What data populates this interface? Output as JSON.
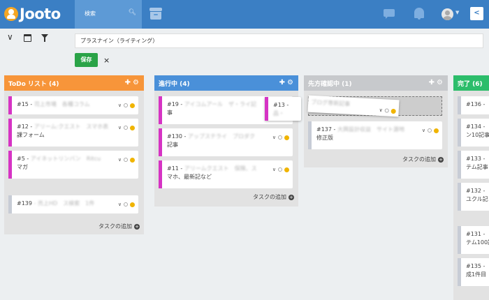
{
  "header": {
    "logo_text": "Jooto",
    "search_label": "検索"
  },
  "toolbar": {
    "project_title": "プラスナイン（ライティング）",
    "save_label": "保存",
    "cancel_label": "×"
  },
  "columns": [
    {
      "title": "ToDo リスト (4)",
      "color": "#f7953a",
      "cards": [
        {
          "id": "#15 -",
          "text": "司上市場　各種コラム",
          "text2": "",
          "bar": "#d633c4"
        },
        {
          "id": "#12 -",
          "text": "アリーム:クエスト　スマホ表",
          "text2": "課フォーム",
          "bar": "#d633c4"
        },
        {
          "id": "#5 -",
          "text": "アイネットリンバン　Ritcu",
          "text2": "マガ",
          "bar": "#d633c4"
        },
        {
          "id": "#139",
          "text": "- 売上HD　ス検索　1件",
          "text2": "",
          "bar": "#c7ccd6"
        }
      ],
      "add_label": "タスクの追加"
    },
    {
      "title": "進行中 (4)",
      "color": "#4a90d9",
      "cards": [
        {
          "id": "#19 -",
          "text": "アイコムアール　ザ・ライ記",
          "text2": "事",
          "bar": "#d633c4"
        },
        {
          "id": "#130 -",
          "text": "アップステライ　プロダク",
          "text2": "記事",
          "bar": "#d633c4"
        },
        {
          "id": "#11 -",
          "text": "アリームクエスト　保険、ス",
          "text2": "マホ、最新記など",
          "bar": "#d633c4"
        }
      ],
      "dragging": {
        "id": "#13 -",
        "text": "品・",
        "bar": "#d633c4"
      },
      "add_label": "タスクの追加"
    },
    {
      "title": "先方確認中 (1)",
      "color": "#c7c9cc",
      "floating_text": "ブログ専新記事",
      "cards": [
        {
          "id": "#137 -",
          "text": "大興設計収益　サイト源地",
          "text2": "修正版",
          "bar": "#c7ccd6"
        }
      ],
      "add_label": "タスクの追加"
    },
    {
      "title": "完了 (6)",
      "color": "#2cbd6b",
      "cards": [
        {
          "id": "#136 -",
          "text": "",
          "text2": ""
        },
        {
          "id": "#134 -",
          "text": "",
          "text2": "ン10記事"
        },
        {
          "id": "#133 -",
          "text": "",
          "text2": "テム記事"
        },
        {
          "id": "#132 -",
          "text": "",
          "text2": "ユクル記"
        },
        {
          "id": "#131 -",
          "text": "",
          "text2": "テム100記"
        },
        {
          "id": "#135 -",
          "text": "",
          "text2": "成1件目"
        }
      ]
    }
  ]
}
